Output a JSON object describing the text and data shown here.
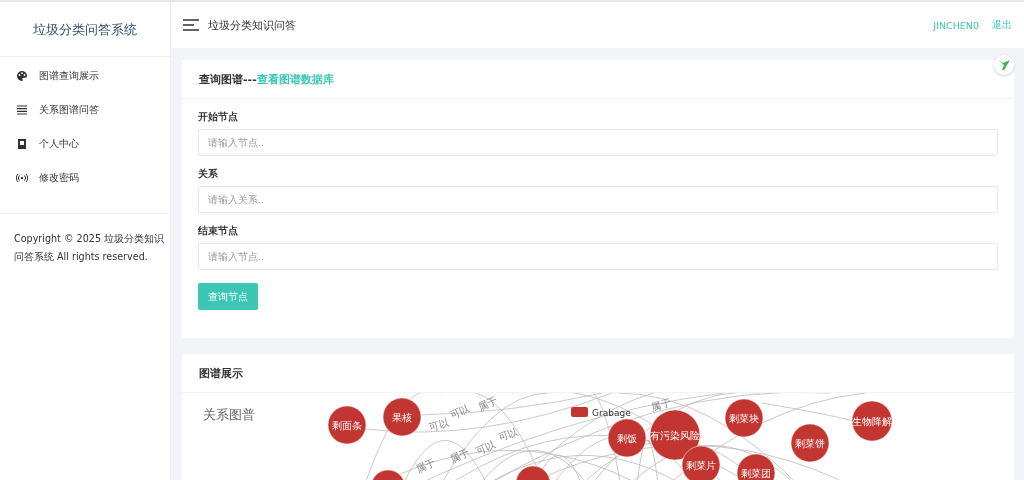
{
  "sidebar": {
    "title": "垃圾分类问答系统",
    "items": [
      {
        "label": "图谱查询展示"
      },
      {
        "label": "关系图谱问答"
      },
      {
        "label": "个人中心"
      },
      {
        "label": "修改密码"
      }
    ],
    "copyright": "Copyright © 2025 垃圾分类知识问答系统 All rights reserved."
  },
  "header": {
    "title": "垃圾分类知识问答",
    "user": "JINCHEN0",
    "logout": "退出"
  },
  "query_card": {
    "title": "查询图谱---",
    "link": "查看图谱数据库",
    "fields": [
      {
        "label": "开始节点",
        "placeholder": "请输入节点.."
      },
      {
        "label": "关系",
        "placeholder": "请输入关系.."
      },
      {
        "label": "结束节点",
        "placeholder": "请输入节点.."
      }
    ],
    "button": "查询节点"
  },
  "graph_card": {
    "title": "图谱展示",
    "graph_title": "关系图普",
    "legend": "Grabage",
    "nodes": [
      {
        "kind": "labeled",
        "label": "剩面条"
      },
      {
        "kind": "labeled",
        "label": "果核"
      },
      {
        "kind": "labeled",
        "label": "剩饭"
      },
      {
        "kind": "labeled",
        "label": "有污染风险"
      },
      {
        "kind": "labeled",
        "label": "剩菜块"
      },
      {
        "kind": "labeled",
        "label": "剩菜饼"
      },
      {
        "kind": "labeled",
        "label": "生物降解"
      },
      {
        "kind": "labeled",
        "label": "剩菜片"
      },
      {
        "kind": "labeled",
        "label": "剩菜团"
      },
      {
        "kind": "cut"
      },
      {
        "kind": "cut"
      }
    ],
    "edge_labels": [
      "可以",
      "属于",
      "可以",
      "属于",
      "可以",
      "属于",
      "可以",
      "属于"
    ]
  }
}
